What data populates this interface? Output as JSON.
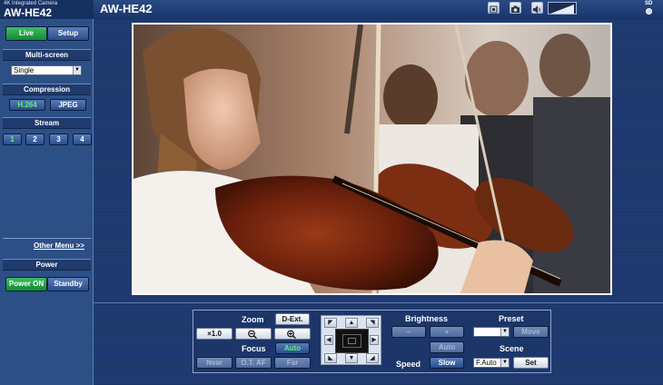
{
  "brand": {
    "subtitle": "4K Integrated Camera",
    "model": "AW-HE42"
  },
  "header": {
    "title": "AW-HE42",
    "sd_label": "SD"
  },
  "icons": {
    "snapshot": "snapshot-icon",
    "camera": "camera-icon",
    "audio": "speaker-icon",
    "signal": "signal-level-icon"
  },
  "mode_tabs": {
    "live": "Live",
    "setup": "Setup"
  },
  "multiscreen": {
    "title": "Multi-screen",
    "selected": "Single"
  },
  "compression": {
    "title": "Compression",
    "h264": "H.264",
    "jpeg": "JPEG"
  },
  "stream": {
    "title": "Stream",
    "s1": "1",
    "s2": "2",
    "s3": "3",
    "s4": "4"
  },
  "other_menu": "Other Menu >>",
  "power": {
    "title": "Power",
    "on": "Power ON",
    "standby": "Standby"
  },
  "zoom": {
    "label": "Zoom",
    "dext": "D-Ext.",
    "x1": "×1.0"
  },
  "focus": {
    "label": "Focus",
    "auto": "Auto",
    "near": "Near",
    "otaf": "O.T. AF",
    "far": "Far"
  },
  "brightness": {
    "label": "Brightness",
    "minus": "−",
    "plus": "+",
    "auto": "Auto"
  },
  "speed": {
    "label": "Speed",
    "value": "Slow"
  },
  "preset": {
    "label": "Preset",
    "selected": "",
    "move": "Move"
  },
  "scene": {
    "label": "Scene",
    "selected": "F.Auto",
    "set": "Set"
  },
  "colors": {
    "live_green": "#17953c",
    "panel_blue": "#2c4f86",
    "bg_blue": "#1e3a6e"
  }
}
